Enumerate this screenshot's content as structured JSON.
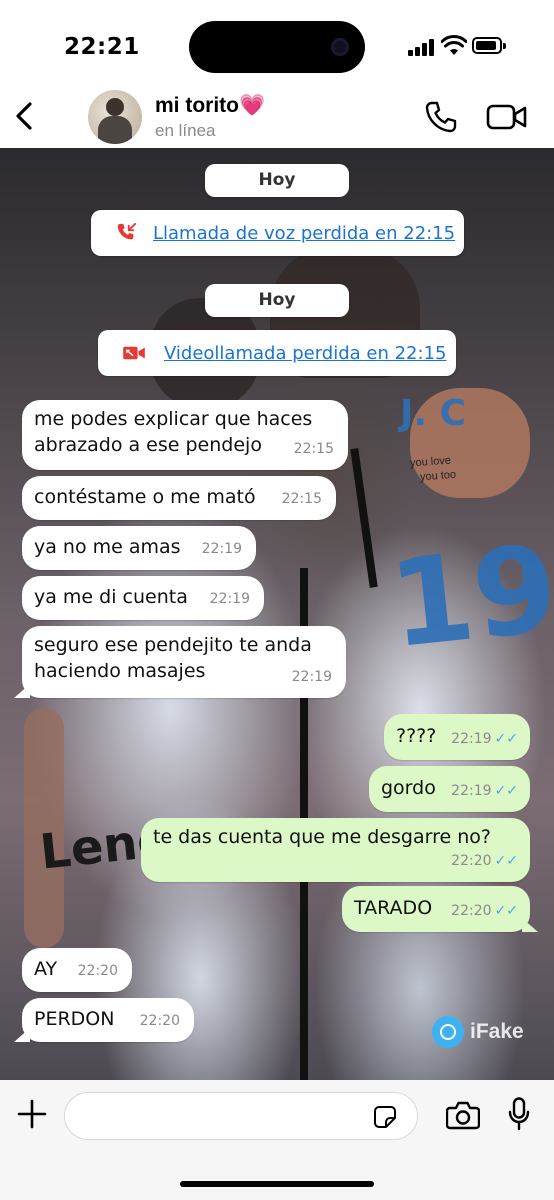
{
  "status_bar": {
    "time": "22:21"
  },
  "header": {
    "contact_name": "mi torito💗",
    "contact_status": "en línea"
  },
  "chat": {
    "date_pills": [
      "Hoy",
      "Hoy"
    ],
    "missed_voice_call": {
      "label": "Llamada de voz perdida en 22:15"
    },
    "missed_video_call": {
      "label": "Videollamada perdida en 22:15"
    },
    "messages": [
      {
        "direction": "in",
        "text": "me podes explicar que haces abrazado a ese pendejo",
        "time": "22:15"
      },
      {
        "direction": "in",
        "text": "contéstame o me mató",
        "time": "22:15"
      },
      {
        "direction": "in",
        "text": "ya no me amas",
        "time": "22:19"
      },
      {
        "direction": "in",
        "text": "ya me di cuenta",
        "time": "22:19"
      },
      {
        "direction": "in",
        "text": "seguro ese pendejito te anda haciendo masajes",
        "time": "22:19"
      },
      {
        "direction": "out",
        "text": "????",
        "time": "22:19",
        "read": true
      },
      {
        "direction": "out",
        "text": "gordo",
        "time": "22:19",
        "read": true
      },
      {
        "direction": "out",
        "text": "te das cuenta que me desgarre no?",
        "time": "22:20",
        "read": true
      },
      {
        "direction": "out",
        "text": "TARADO",
        "time": "22:20",
        "read": true
      },
      {
        "direction": "in",
        "text": "AY",
        "time": "22:20"
      },
      {
        "direction": "in",
        "text": "PERDON",
        "time": "22:20"
      }
    ],
    "ticks_glyph": "✓✓",
    "background_jersey_text": [
      "J. C",
      "19",
      "you love",
      "you too",
      "Leno"
    ]
  },
  "watermark": {
    "text": "iFake"
  },
  "composer": {
    "placeholder": "",
    "value": ""
  },
  "colors": {
    "outgoing_bubble": "#dcf8c6",
    "incoming_bubble": "#ffffff",
    "missed_call_red": "#e53935",
    "link_blue": "#1a73d8",
    "read_ticks": "#4fa7e8"
  },
  "icons": [
    "back-chevron-icon",
    "phone-icon",
    "video-camera-icon",
    "missed-call-icon",
    "missed-video-icon",
    "ifake-logo-icon",
    "plus-icon",
    "sticker-icon",
    "camera-icon",
    "microphone-icon"
  ]
}
